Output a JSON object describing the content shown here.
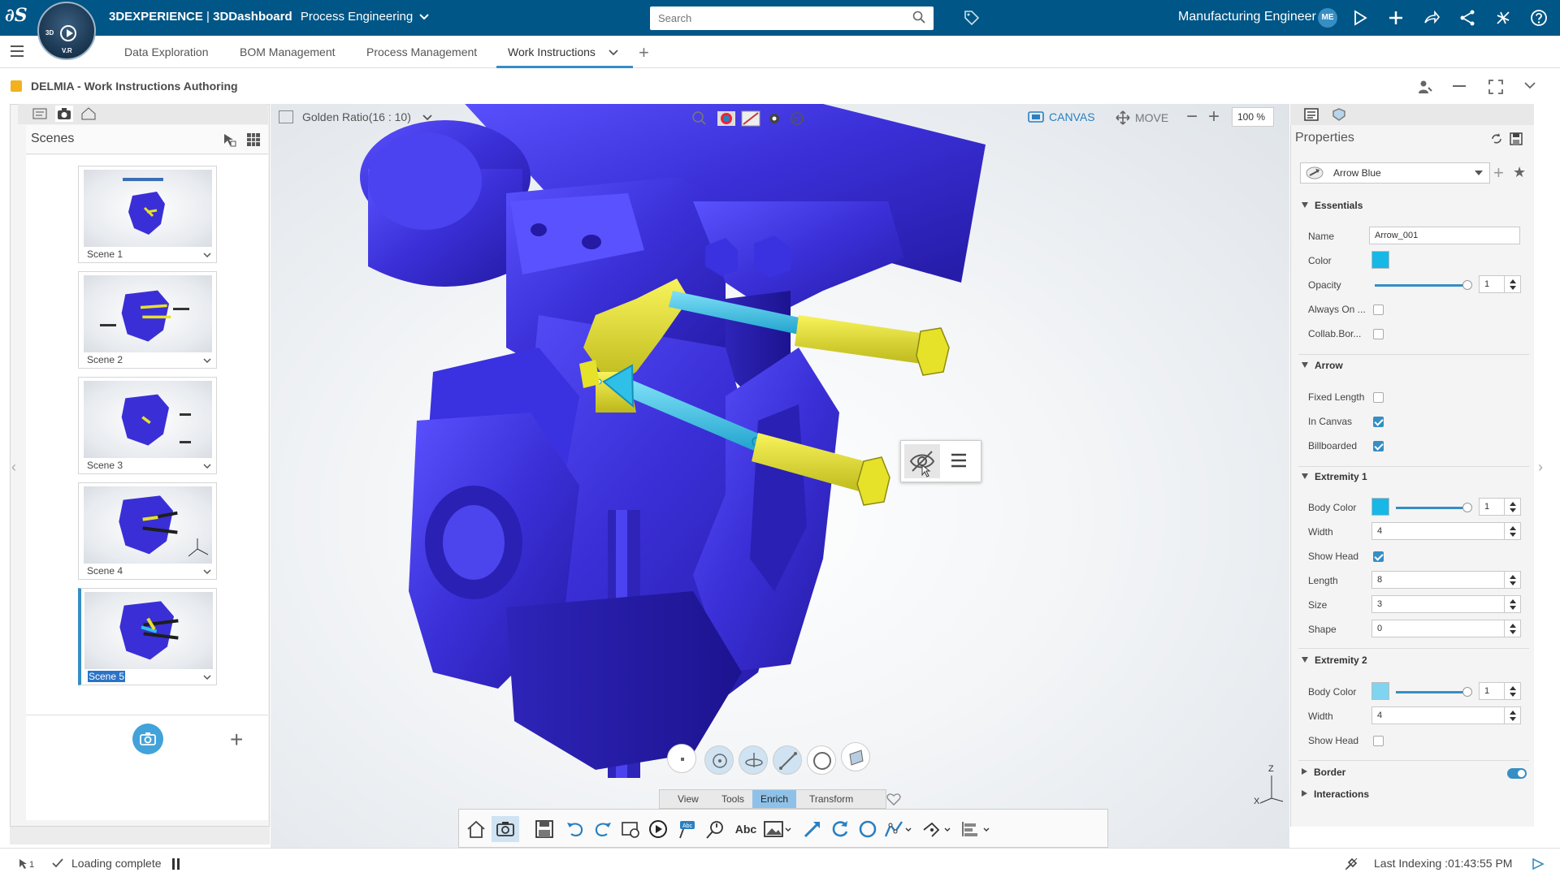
{
  "topbar": {
    "brand": "3DEXPERIENCE",
    "separator": " | ",
    "dashboard": "3DDashboard",
    "space": "Process Engineering",
    "compass_label_3d": "3D",
    "compass_label_vr": "V.R",
    "search_placeholder": "Search",
    "user_name": "Manufacturing Engineer",
    "user_initials": "ME",
    "bg_color": "#005686"
  },
  "tabs": [
    {
      "label": "Data Exploration"
    },
    {
      "label": "BOM Management"
    },
    {
      "label": "Process Management"
    },
    {
      "label": "Work Instructions",
      "active": true
    }
  ],
  "app": {
    "title": "DELMIA - Work Instructions Authoring"
  },
  "scenes_panel": {
    "title": "Scenes",
    "scenes": [
      {
        "label": "Scene 1"
      },
      {
        "label": "Scene 2"
      },
      {
        "label": "Scene 3"
      },
      {
        "label": "Scene 4"
      },
      {
        "label": "Scene 5",
        "selected": true
      }
    ]
  },
  "viewport": {
    "ratio_label": "Golden Ratio(16 : 10)",
    "canvas_label": "CANVAS",
    "move_label": "MOVE",
    "zoom": "100 %",
    "model_color": "#3a2fd6",
    "arrow_color": "#2fc0e8",
    "bolt_color": "#e6e22a",
    "command_tabs": [
      {
        "label": "View"
      },
      {
        "label": "Tools"
      },
      {
        "label": "Enrich",
        "active": true
      },
      {
        "label": "Transform"
      }
    ],
    "text_tool_label": "Abc",
    "triad_z": "Z",
    "triad_x": "X"
  },
  "properties": {
    "title": "Properties",
    "style_name": "Arrow Blue",
    "essentials": {
      "section": "Essentials",
      "name_label": "Name",
      "name_value": "Arrow_001",
      "color_label": "Color",
      "color_value": "#17b7e6",
      "opacity_label": "Opacity",
      "opacity_value": "1",
      "always_on_label": "Always On ...",
      "collab_label": "Collab.Bor...",
      "always_on": false,
      "collab": false
    },
    "arrow": {
      "section": "Arrow",
      "fixed_length_label": "Fixed Length",
      "in_canvas_label": "In Canvas",
      "billboarded_label": "Billboarded",
      "fixed_length": false,
      "in_canvas": true,
      "billboarded": true
    },
    "extremity1": {
      "section": "Extremity 1",
      "body_color_label": "Body Color",
      "body_color": "#17b7e6",
      "body_opacity": "1",
      "width_label": "Width",
      "width": "4",
      "show_head_label": "Show Head",
      "show_head": true,
      "length_label": "Length",
      "length": "8",
      "size_label": "Size",
      "size": "3",
      "shape_label": "Shape",
      "shape": "0"
    },
    "extremity2": {
      "section": "Extremity 2",
      "body_color_label": "Body Color",
      "body_color": "#7fd4ef",
      "body_opacity": "1",
      "width_label": "Width",
      "width": "4",
      "show_head_label": "Show Head",
      "show_head": false
    },
    "border_section": "Border",
    "border_on": true,
    "interactions_section": "Interactions"
  },
  "status": {
    "selection_count": "1",
    "loading": "Loading complete",
    "indexing": "Last Indexing :01:43:55 PM"
  }
}
